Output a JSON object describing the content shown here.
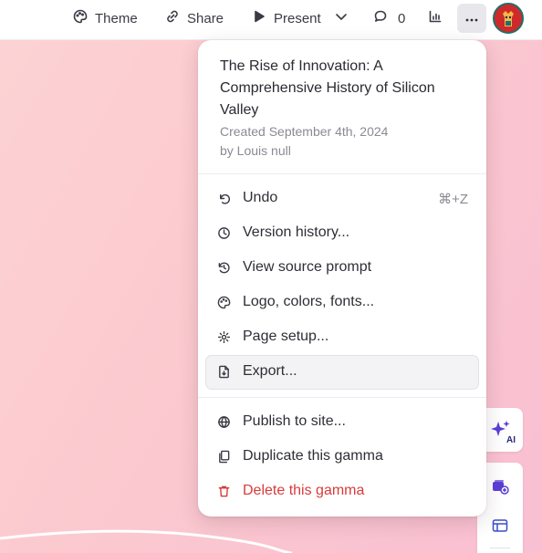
{
  "toolbar": {
    "theme_label": "Theme",
    "share_label": "Share",
    "present_label": "Present",
    "comments_count": "0"
  },
  "menu": {
    "title": "The Rise of Innovation: A Comprehensive History of Silicon Valley",
    "created": "Created September 4th, 2024",
    "author": "by Louis null",
    "items": [
      {
        "label": "Undo",
        "shortcut": "⌘+Z",
        "icon": "undo-icon"
      },
      {
        "label": "Version history...",
        "icon": "clock-icon"
      },
      {
        "label": "View source prompt",
        "icon": "history-icon"
      },
      {
        "label": "Logo, colors, fonts...",
        "icon": "palette-icon"
      },
      {
        "label": "Page setup...",
        "icon": "gear-icon"
      },
      {
        "label": "Export...",
        "icon": "file-export-icon"
      },
      {
        "label": "Publish to site...",
        "icon": "globe-icon"
      },
      {
        "label": "Duplicate this gamma",
        "icon": "duplicate-icon"
      },
      {
        "label": "Delete this gamma",
        "icon": "trash-icon"
      }
    ]
  },
  "side": {
    "ai_label": "AI"
  },
  "colors": {
    "accent_purple": "#5b3fd6",
    "danger": "#d93b3b"
  }
}
